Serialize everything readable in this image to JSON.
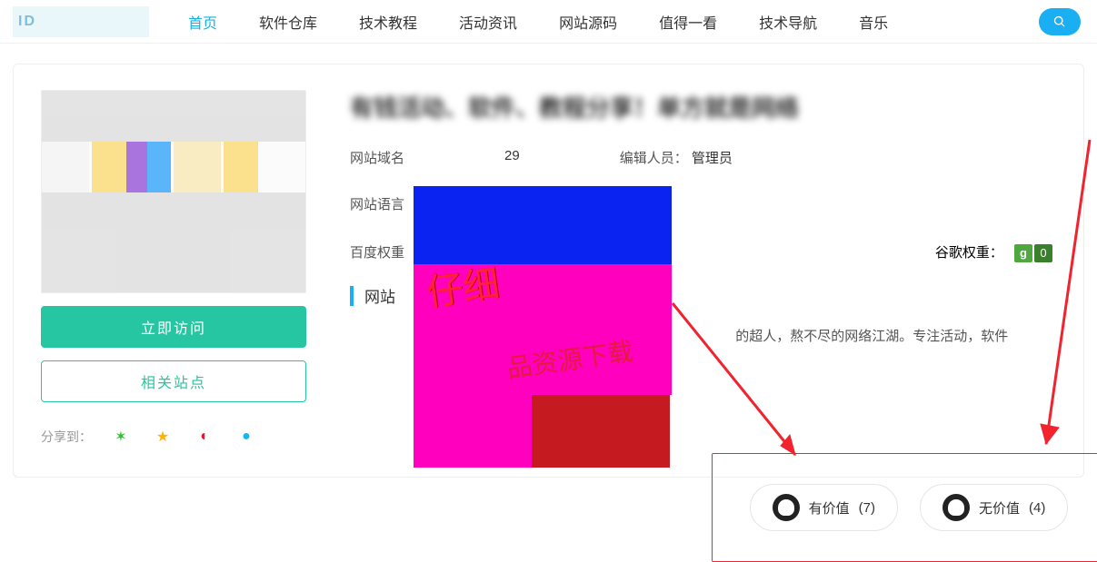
{
  "nav": {
    "items": [
      "首页",
      "软件仓库",
      "技术教程",
      "活动资讯",
      "网站源码",
      "值得一看",
      "技术导航",
      "音乐"
    ],
    "active_index": 0
  },
  "page_title": "有钱活动、软件、教程分享！单方就是网络",
  "meta": {
    "domain_label": "网站域名",
    "date_fragment": "29",
    "editor_label": "编辑人员：",
    "editor_value": "管理员",
    "language_label": "网站语言",
    "baidu_weight_label": "百度权重",
    "google_weight_label": "谷歌权重：",
    "google_weight_value": "0"
  },
  "buttons": {
    "visit": "立即访问",
    "related": "相关站点"
  },
  "section_head": "网站",
  "description_tail": "的超人，熬不尽的网络江湖。专注活动，软件",
  "annotations": {
    "hw1": "仔细",
    "hw2": "品资源下载"
  },
  "vote": {
    "helpful_label": "有价值",
    "helpful_count": "(7)",
    "unhelpful_label": "无价值",
    "unhelpful_count": "(4)"
  },
  "share": {
    "label": "分享到："
  }
}
